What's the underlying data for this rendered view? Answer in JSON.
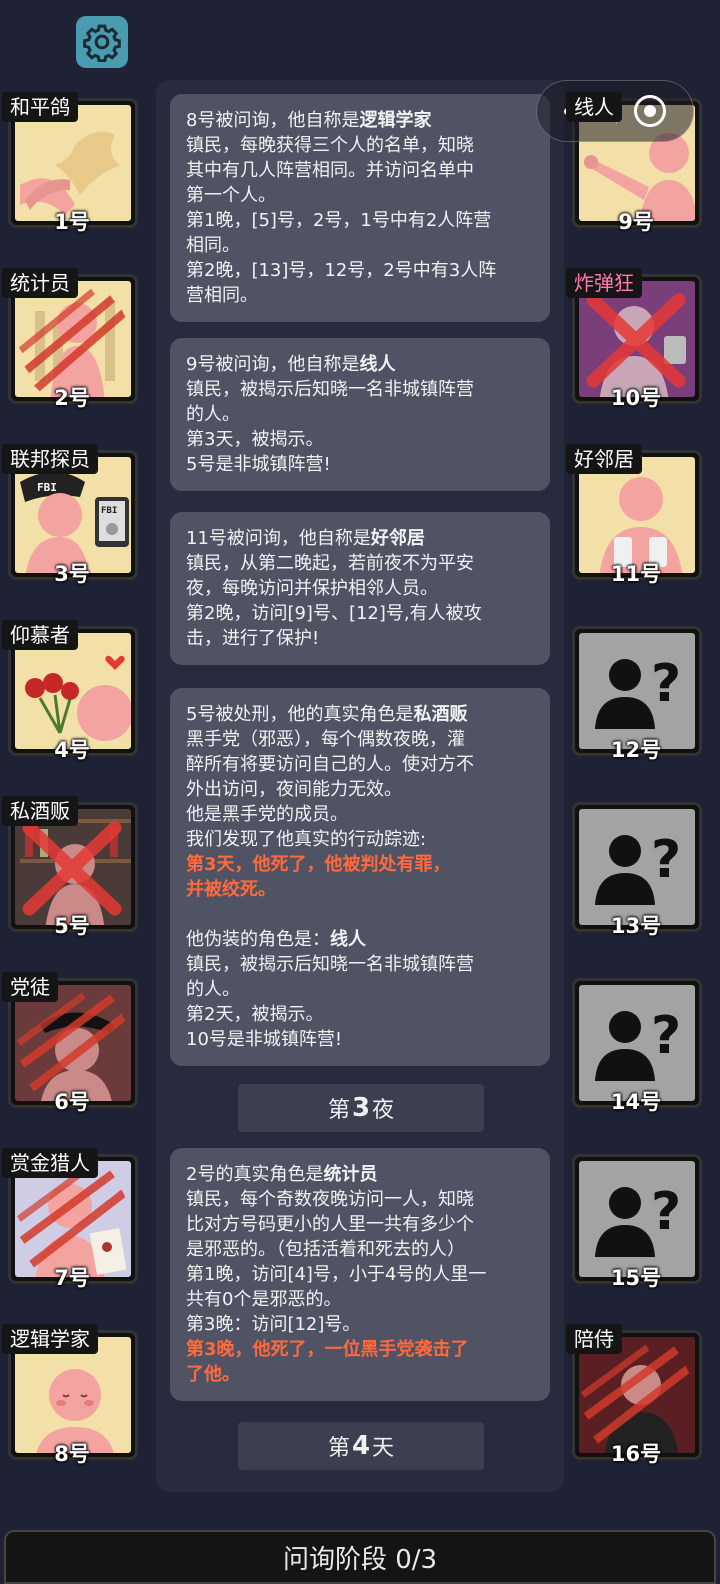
{
  "top": {
    "settings_icon": "gear-icon",
    "capsule_more_icon": "more-dots-icon",
    "capsule_close_icon": "target-circle-icon"
  },
  "players_left": [
    {
      "role": "和平鸽",
      "num": "1号",
      "dead": false,
      "bg": "#f3dfa8"
    },
    {
      "role": "统计员",
      "num": "2号",
      "dead": true,
      "bg": "#f3dfa8"
    },
    {
      "role": "联邦探员",
      "num": "3号",
      "dead": false,
      "bg": "#f3dfa8"
    },
    {
      "role": "仰慕者",
      "num": "4号",
      "dead": false,
      "bg": "#f3dfa8"
    },
    {
      "role": "私酒贩",
      "num": "5号",
      "dead": true,
      "bg": "#5a4a48"
    },
    {
      "role": "党徒",
      "num": "6号",
      "dead": true,
      "bg": "#6b3a3a"
    },
    {
      "role": "赏金猎人",
      "num": "7号",
      "dead": true,
      "bg": "#cfcde6"
    },
    {
      "role": "逻辑学家",
      "num": "8号",
      "dead": false,
      "bg": "#f3dfa8"
    }
  ],
  "players_right": [
    {
      "role": "线人",
      "num": "9号",
      "dead": false
    },
    {
      "role": "炸弹狂",
      "num": "10号",
      "dead": true
    },
    {
      "role": "好邻居",
      "num": "11号",
      "dead": false
    },
    {
      "role": "",
      "num": "12号",
      "unknown": true
    },
    {
      "role": "",
      "num": "13号",
      "unknown": true
    },
    {
      "role": "",
      "num": "14号",
      "unknown": true
    },
    {
      "role": "",
      "num": "15号",
      "unknown": true
    },
    {
      "role": "陪侍",
      "num": "16号",
      "dead": true
    }
  ],
  "log": {
    "m1": {
      "l1a": "8号被问询，他自称是",
      "l1b": "逻辑学家",
      "l2": "镇民，每晚获得三个人的名单，知晓",
      "l3": "其中有几人阵营相同。并访问名单中",
      "l4": "第一个人。",
      "l5": "第1晚，[5]号，2号，1号中有2人阵营",
      "l6": "相同。",
      "l7": "第2晚，[13]号，12号，2号中有3人阵",
      "l8": "营相同。"
    },
    "m2": {
      "l1a": "9号被问询，他自称是",
      "l1b": "线人",
      "l2": "镇民，被揭示后知晓一名非城镇阵营",
      "l3": "的人。",
      "l4": "第3天，被揭示。",
      "l5": "5号是非城镇阵营!"
    },
    "m3": {
      "l1a": "11号被问询，他自称是",
      "l1b": "好邻居",
      "l2": "镇民，从第二晚起，若前夜不为平安",
      "l3": "夜，每晚访问并保护相邻人员。",
      "l4": "第2晚，访问[9]号、[12]号,有人被攻",
      "l5": "击，进行了保护!"
    },
    "m4": {
      "l1a": "5号被处刑，他的真实角色是",
      "l1b": "私酒贩",
      "l2": "黑手党（邪恶），每个偶数夜晚，灌",
      "l3": "醉所有将要访问自己的人。使对方不",
      "l4": "外出访问，夜间能力无效。",
      "l5": "他是黑手党的成员。",
      "l6": "我们发现了他真实的行动踪迹:",
      "r1": "第3天，他死了，他被判处有罪，",
      "r2": "并被绞死。",
      "l7a": "他伪装的角色是：",
      "l7b": "线人",
      "l8": "镇民，被揭示后知晓一名非城镇阵营",
      "l9": "的人。",
      "l10": "第2天，被揭示。",
      "l11": "10号是非城镇阵营!"
    },
    "div1": {
      "a": "第",
      "b": "3",
      "c": "夜"
    },
    "m5": {
      "l1a": "2号的真实角色是",
      "l1b": "统计员",
      "l2": "镇民，每个奇数夜晚访问一人，知晓",
      "l3": "比对方号码更小的人里一共有多少个",
      "l4": "是邪恶的。（包括活着和死去的人）",
      "l5": "第1晚，访问[4]号，小于4号的人里一",
      "l6": "共有0个是邪恶的。",
      "l7": "第3晚：访问[12]号。",
      "r1": "第3晚，他死了，一位黑手党袭击了",
      "r2": "了他。"
    },
    "div2": {
      "a": "第",
      "b": "4",
      "c": "天"
    }
  },
  "bottom": {
    "phase_label": "问询阶段 0/3"
  }
}
